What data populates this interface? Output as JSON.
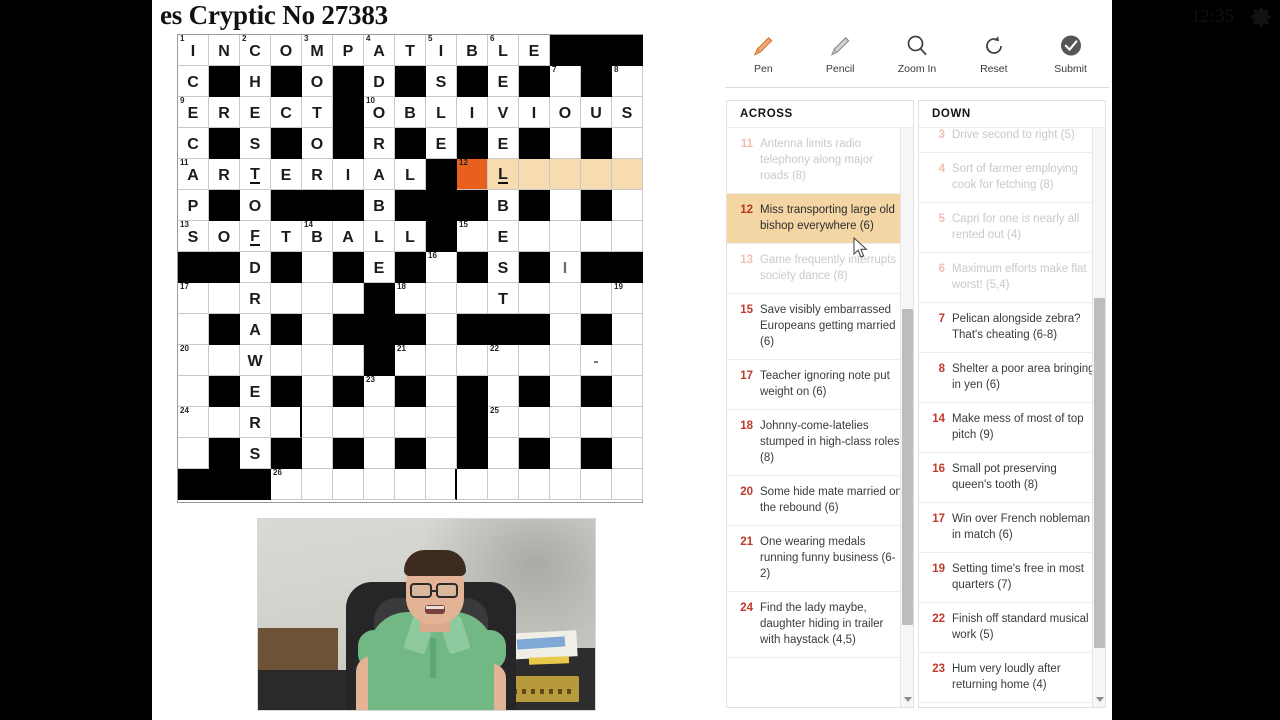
{
  "header": {
    "title": "es Cryptic No 27383",
    "clock": "12:35",
    "gear_icon": "gear-icon"
  },
  "toolbar": {
    "items": [
      {
        "label": "Pen",
        "icon": "pen-icon",
        "color": "#e0813f"
      },
      {
        "label": "Pencil",
        "icon": "pencil-icon",
        "color": "#9b9b9b"
      },
      {
        "label": "Zoom In",
        "icon": "magnifier-icon",
        "color": "#4a4a4a"
      },
      {
        "label": "Reset",
        "icon": "reset-icon",
        "color": "#4a4a4a"
      },
      {
        "label": "Submit",
        "icon": "check-circle-icon",
        "color": "#4a4a4a"
      }
    ]
  },
  "colors": {
    "active_cell": "#e9601d",
    "highlight_cell": "#f7dcb2",
    "clue_number": "#c0392b",
    "selected_clue_bg": "#f3d6a4",
    "block_cell": "#000000"
  },
  "grid": {
    "cols": 15,
    "rows": 15,
    "cells": [
      [
        {
          "n": "1",
          "l": "I"
        },
        {
          "l": "N"
        },
        {
          "n": "2",
          "l": "C"
        },
        {
          "l": "O"
        },
        {
          "n": "3",
          "l": "M"
        },
        {
          "l": "P"
        },
        {
          "n": "4",
          "l": "A"
        },
        {
          "l": "T"
        },
        {
          "n": "5",
          "l": "I"
        },
        {
          "l": "B"
        },
        {
          "n": "6",
          "l": "L"
        },
        {
          "l": "E"
        },
        {
          "b": 1
        },
        {
          "b": 1
        },
        {
          "b": 1
        }
      ],
      [
        {
          "l": "C"
        },
        {
          "b": 1
        },
        {
          "l": "H"
        },
        {
          "b": 1
        },
        {
          "l": "O"
        },
        {
          "b": 1
        },
        {
          "l": "D"
        },
        {
          "b": 1
        },
        {
          "l": "S"
        },
        {
          "b": 1
        },
        {
          "l": "E"
        },
        {
          "b": 1
        },
        {
          "n": "7"
        },
        {
          "b": 1
        },
        {
          "n": "8"
        }
      ],
      [
        {
          "n": "9",
          "l": "E"
        },
        {
          "l": "R"
        },
        {
          "l": "E"
        },
        {
          "l": "C"
        },
        {
          "l": "T"
        },
        {
          "b": 1
        },
        {
          "n": "10",
          "l": "O"
        },
        {
          "l": "B"
        },
        {
          "l": "L"
        },
        {
          "l": "I"
        },
        {
          "l": "V"
        },
        {
          "l": "I"
        },
        {
          "l": "O"
        },
        {
          "l": "U"
        },
        {
          "l": "S"
        }
      ],
      [
        {
          "l": "C"
        },
        {
          "b": 1
        },
        {
          "l": "S"
        },
        {
          "b": 1
        },
        {
          "l": "O"
        },
        {
          "b": 1
        },
        {
          "l": "R"
        },
        {
          "b": 1
        },
        {
          "l": "E"
        },
        {
          "b": 1
        },
        {
          "l": "E"
        },
        {
          "b": 1
        },
        {
          "e": 1
        },
        {
          "b": 1
        },
        {
          "e": 1
        }
      ],
      [
        {
          "n": "11",
          "l": "A"
        },
        {
          "l": "R"
        },
        {
          "l": "T",
          "u": 1
        },
        {
          "l": "E"
        },
        {
          "l": "R"
        },
        {
          "l": "I"
        },
        {
          "l": "A"
        },
        {
          "l": "L"
        },
        {
          "b": 1
        },
        {
          "n": "12",
          "a": 1
        },
        {
          "l": "L",
          "h": 1,
          "u": 1
        },
        {
          "h": 1
        },
        {
          "h": 1
        },
        {
          "h": 1
        },
        {
          "h": 1
        }
      ],
      [
        {
          "l": "P"
        },
        {
          "b": 1
        },
        {
          "l": "O"
        },
        {
          "b": 1
        },
        {
          "b": 1
        },
        {
          "b": 1
        },
        {
          "l": "B"
        },
        {
          "b": 1
        },
        {
          "b": 1
        },
        {
          "b": 1
        },
        {
          "l": "B"
        },
        {
          "b": 1
        },
        {
          "e": 1
        },
        {
          "b": 1
        },
        {
          "e": 1
        }
      ],
      [
        {
          "n": "13",
          "l": "S"
        },
        {
          "l": "O"
        },
        {
          "l": "F",
          "u": 1
        },
        {
          "l": "T"
        },
        {
          "n": "14",
          "l": "B"
        },
        {
          "l": "A"
        },
        {
          "l": "L"
        },
        {
          "l": "L"
        },
        {
          "b": 1
        },
        {
          "n": "15"
        },
        {
          "l": "E"
        },
        {
          "e": 1
        },
        {
          "e": 1
        },
        {
          "e": 1
        },
        {
          "e": 1
        }
      ],
      [
        {
          "b": 1
        },
        {
          "b": 1
        },
        {
          "l": "D"
        },
        {
          "b": 1
        },
        {
          "e": 1
        },
        {
          "b": 1
        },
        {
          "l": "E"
        },
        {
          "b": 1
        },
        {
          "n": "16"
        },
        {
          "b": 1
        },
        {
          "l": "S"
        },
        {
          "b": 1
        },
        {
          "l": "I",
          "p": 1
        },
        {
          "b": 1
        },
        {
          "b": 1
        }
      ],
      [
        {
          "n": "17"
        },
        {
          "e": 1
        },
        {
          "l": "R"
        },
        {
          "e": 1
        },
        {
          "e": 1
        },
        {
          "e": 1
        },
        {
          "b": 1
        },
        {
          "n": "18"
        },
        {
          "e": 1
        },
        {
          "e": 1
        },
        {
          "l": "T"
        },
        {
          "e": 1
        },
        {
          "e": 1
        },
        {
          "e": 1
        },
        {
          "n": "19"
        }
      ],
      [
        {
          "e": 1
        },
        {
          "b": 1
        },
        {
          "l": "A"
        },
        {
          "b": 1
        },
        {
          "e": 1
        },
        {
          "b": 1
        },
        {
          "b": 1
        },
        {
          "b": 1
        },
        {
          "e": 1
        },
        {
          "b": 1
        },
        {
          "b": 1
        },
        {
          "b": 1
        },
        {
          "e": 1
        },
        {
          "b": 1
        },
        {
          "e": 1
        }
      ],
      [
        {
          "n": "20"
        },
        {
          "e": 1
        },
        {
          "l": "W"
        },
        {
          "e": 1
        },
        {
          "e": 1
        },
        {
          "e": 1
        },
        {
          "b": 1
        },
        {
          "n": "21"
        },
        {
          "e": 1
        },
        {
          "e": 1
        },
        {
          "n": "22"
        },
        {
          "e": 1
        },
        {
          "e": 1
        },
        {
          "l": "-",
          "p": 1
        },
        {
          "e": 1
        }
      ],
      [
        {
          "e": 1
        },
        {
          "b": 1
        },
        {
          "l": "E"
        },
        {
          "b": 1
        },
        {
          "e": 1
        },
        {
          "b": 1
        },
        {
          "n": "23"
        },
        {
          "b": 1
        },
        {
          "e": 1
        },
        {
          "b": 1
        },
        {
          "e": 1
        },
        {
          "b": 1
        },
        {
          "e": 1
        },
        {
          "b": 1
        },
        {
          "e": 1
        }
      ],
      [
        {
          "n": "24"
        },
        {
          "e": 1
        },
        {
          "l": "R"
        },
        {
          "e": 1,
          "tr": 1
        },
        {
          "e": 1
        },
        {
          "e": 1
        },
        {
          "e": 1
        },
        {
          "e": 1
        },
        {
          "e": 1
        },
        {
          "b": 1
        },
        {
          "n": "25"
        },
        {
          "e": 1
        },
        {
          "e": 1
        },
        {
          "e": 1
        },
        {
          "e": 1
        }
      ],
      [
        {
          "e": 1
        },
        {
          "b": 1
        },
        {
          "l": "S"
        },
        {
          "b": 1
        },
        {
          "e": 1
        },
        {
          "b": 1
        },
        {
          "e": 1
        },
        {
          "b": 1
        },
        {
          "e": 1
        },
        {
          "b": 1
        },
        {
          "e": 1
        },
        {
          "b": 1
        },
        {
          "e": 1
        },
        {
          "b": 1
        },
        {
          "e": 1
        }
      ],
      [
        {
          "b": 1
        },
        {
          "b": 1
        },
        {
          "b": 1
        },
        {
          "n": "26"
        },
        {
          "e": 1
        },
        {
          "e": 1
        },
        {
          "e": 1
        },
        {
          "e": 1
        },
        {
          "e": 1,
          "tr": 1
        },
        {
          "e": 1
        },
        {
          "e": 1
        },
        {
          "e": 1
        },
        {
          "e": 1
        },
        {
          "e": 1
        },
        {
          "e": 1
        }
      ]
    ]
  },
  "across": {
    "heading": "ACROSS",
    "clues": [
      {
        "num": "11",
        "text": "Antenna limits radio telephony along major roads (8)",
        "state": "done"
      },
      {
        "num": "12",
        "text": "Miss transporting large old bishop everywhere (6)",
        "state": "selected"
      },
      {
        "num": "13",
        "text": "Game frequently interrupts society dance (8)",
        "state": "done"
      },
      {
        "num": "15",
        "text": "Save visibly embarrassed Europeans getting married (6)",
        "state": "normal"
      },
      {
        "num": "17",
        "text": "Teacher ignoring note put weight on (6)",
        "state": "normal"
      },
      {
        "num": "18",
        "text": "Johnny-come-latelies stumped in high-class roles (8)",
        "state": "normal"
      },
      {
        "num": "20",
        "text": "Some hide mate married on the rebound (6)",
        "state": "normal"
      },
      {
        "num": "21",
        "text": "One wearing medals running funny business (6-2)",
        "state": "normal"
      },
      {
        "num": "24",
        "text": "Find the lady maybe, daughter hiding in trailer with haystack (4,5)",
        "state": "normal"
      }
    ],
    "scroll_thumb": {
      "top": 0.32,
      "height": 0.56
    }
  },
  "down": {
    "heading": "DOWN",
    "clues": [
      {
        "num": "3",
        "text": "Drive second to right (5)",
        "state": "done"
      },
      {
        "num": "4",
        "text": "Sort of farmer employing cook for fetching (8)",
        "state": "done"
      },
      {
        "num": "5",
        "text": "Capri for one is nearly all rented out (4)",
        "state": "done"
      },
      {
        "num": "6",
        "text": "Maximum efforts make flat worst! (5,4)",
        "state": "done"
      },
      {
        "num": "7",
        "text": "Pelican alongside zebra? That's cheating (6-8)",
        "state": "normal"
      },
      {
        "num": "8",
        "text": "Shelter a poor area bringing in yen (6)",
        "state": "normal"
      },
      {
        "num": "14",
        "text": "Make mess of most of top pitch (9)",
        "state": "normal"
      },
      {
        "num": "16",
        "text": "Small pot preserving queen's tooth (8)",
        "state": "normal"
      },
      {
        "num": "17",
        "text": "Win over French nobleman in match (6)",
        "state": "normal"
      },
      {
        "num": "19",
        "text": "Setting time's free in most quarters (7)",
        "state": "normal"
      },
      {
        "num": "22",
        "text": "Finish off standard musical work (5)",
        "state": "normal"
      },
      {
        "num": "23",
        "text": "Hum very loudly after returning home (4)",
        "state": "normal"
      }
    ],
    "scroll_thumb": {
      "top": 0.3,
      "height": 0.62
    }
  },
  "webcam": {
    "name": "webcam-video-overlay"
  }
}
